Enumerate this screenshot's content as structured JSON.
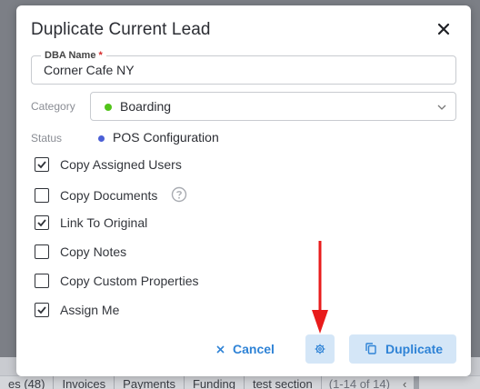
{
  "background": {
    "tabs": [
      "es (48)",
      "Invoices",
      "Payments",
      "Funding",
      "test section"
    ],
    "pager": "(1-14 of 14)"
  },
  "dialog": {
    "title": "Duplicate Current Lead",
    "close_icon": "close-icon"
  },
  "dba": {
    "label": "DBA Name",
    "required_mark": "*",
    "value": "Corner Cafe NY"
  },
  "category": {
    "label": "Category",
    "value": "Boarding",
    "dot_color": "#52c41a"
  },
  "status": {
    "label": "Status",
    "value": "POS Configuration",
    "dot_color": "#4b5fd6"
  },
  "options": [
    {
      "label": "Copy Assigned Users",
      "checked": true
    },
    {
      "label": "Copy Documents",
      "checked": false,
      "help_icon": "question-circle-icon"
    },
    {
      "label": "Link To Original",
      "checked": true
    },
    {
      "label": "Copy Notes",
      "checked": false
    },
    {
      "label": "Copy Custom Properties",
      "checked": false
    },
    {
      "label": "Assign Me",
      "checked": true
    }
  ],
  "footer": {
    "cancel_label": "Cancel",
    "settings_icon": "gear-icon",
    "duplicate_label": "Duplicate",
    "duplicate_icon": "copy-icon"
  },
  "colors": {
    "accent": "#2f83d6",
    "button_bg": "#d4e6f7",
    "annotation": "#e81b1b"
  }
}
